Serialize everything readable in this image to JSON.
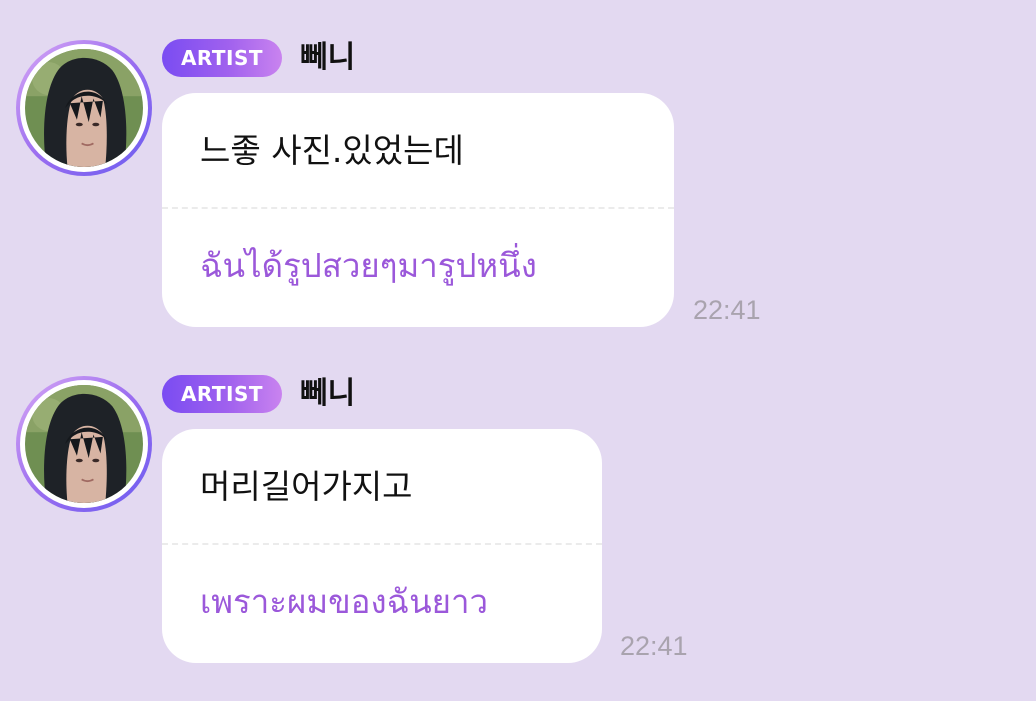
{
  "messages": [
    {
      "badge": "ARTIST",
      "sender": "뻬니",
      "original": "느좋 사진.있었는데",
      "translation": "ฉันได้รูปสวยๆมารูปหนึ่ง",
      "time": "22:41"
    },
    {
      "badge": "ARTIST",
      "sender": "뻬니",
      "original": "머리길어가지고",
      "translation": "เพราะผมของฉันยาว",
      "time": "22:41"
    }
  ],
  "colors": {
    "background": "#e3d9f1",
    "bubble": "#ffffff",
    "translation_text": "#9b58da",
    "timestamp": "#a9a3ae",
    "badge_start": "#7a4cf2",
    "badge_end": "#c983ef"
  }
}
